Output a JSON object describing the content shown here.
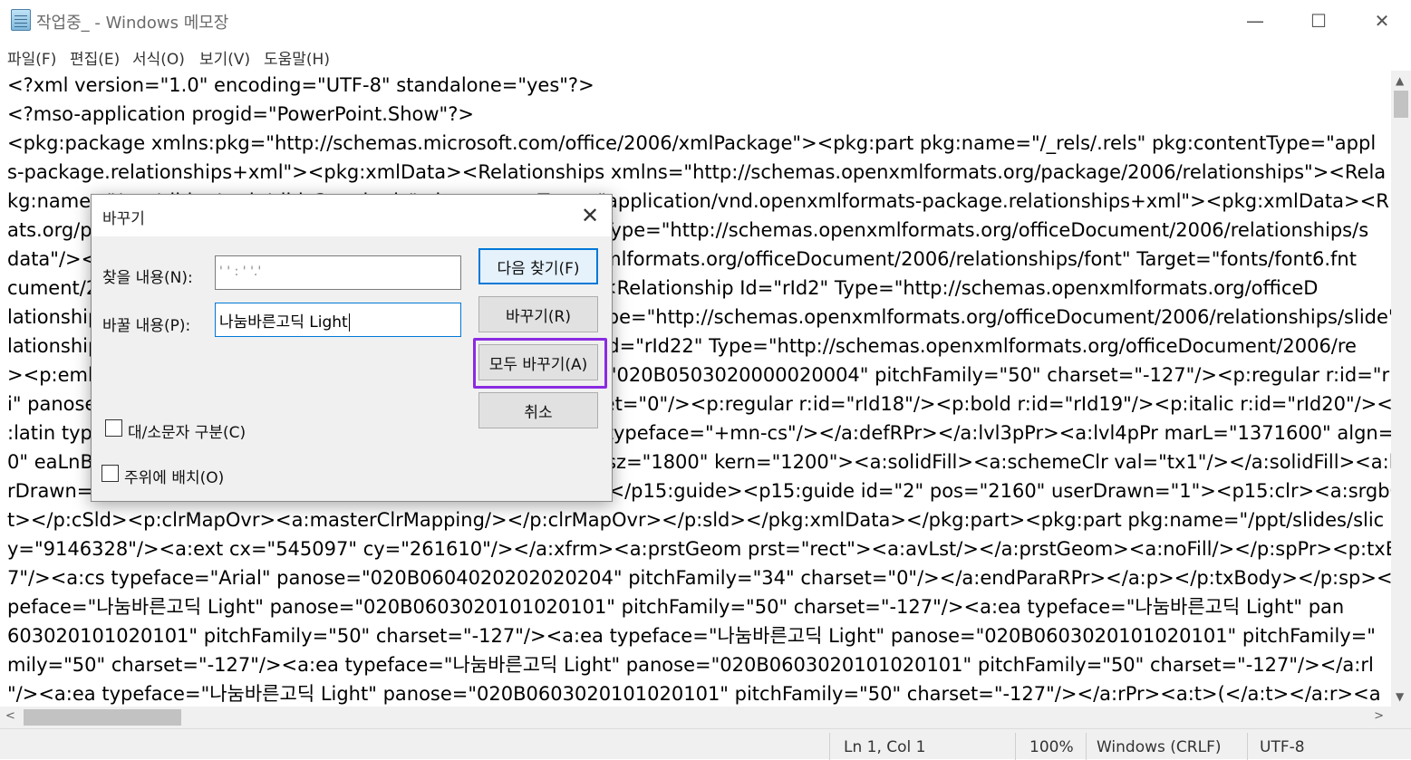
{
  "window": {
    "title": "작업중_ - Windows 메모장",
    "minimize": "—",
    "maximize": "☐",
    "close": "✕"
  },
  "menu": [
    "파일(F)",
    "편집(E)",
    "서식(O)",
    "보기(V)",
    "도움말(H)"
  ],
  "editor_lines": [
    "<?xml version=\"1.0\" encoding=\"UTF-8\" standalone=\"yes\"?>",
    "<?mso-application progid=\"PowerPoint.Show\"?>",
    "<pkg:package xmlns:pkg=\"http://schemas.microsoft.com/office/2006/xmlPackage\"><pkg:part pkg:name=\"/_rels/.rels\" pkg:contentType=\"appl",
    "s-package.relationships+xml\"><pkg:xmlData><Relationships xmlns=\"http://schemas.openxmlformats.org/package/2006/relationships\"><Rela",
    "kg:name=\"/ppt/slides/_rels/slide3.xml.rels\" pkg:contentType=\"application/vnd.openxmlformats-package.relationships+xml\"><pkg:xmlData><R",
    "ats.org/package/2006/relationships\"><Relationship Id=\"rId8\" Type=\"http://schemas.openxmlformats.org/officeDocument/2006/relationships/s",
    "data\"/><Relationship Id=\"rId13\" Type=\"http://schemas.openxmlformats.org/officeDocument/2006/relationships/font\" Target=\"fonts/font6.fnt",
    "cument/2006/relationships/slide\" Target=\"slides/slide3.xml\"/><Relationship Id=\"rId2\" Type=\"http://schemas.openxmlformats.org/officeD",
    "lationships/slide\" Target=\"slides/slide2.xml\"/><Relationship Type=\"http://schemas.openxmlformats.org/officeDocument/2006/relationships/slide\" Target=\"slides/slide4.xml\"/><Relatio",
    "lationships/font\" Target=\"fonts/font3.fntdata\"/><Relationship Id=\"rId22\" Type=\"http://schemas.openxmlformats.org/officeDocument/2006/re",
    "><p:embeddedFont><p:font typeface=\"나눔바른고딕\" panose=\"020B0503020000020004\" pitchFamily=\"50\" charset=\"-127\"/><p:regular r:id=\"rId",
    "i\" panose=\"020B0604020202020204\" pitchFamily=\"34\" charset=\"0\"/><p:regular r:id=\"rId18\"/><p:bold r:id=\"rId19\"/><p:italic r:id=\"rId20\"/><p",
    ":latin typeface=\"+mn-lt\"/><a:ea typeface=\"+mn-ea\"/><a:cs typeface=\"+mn-cs\"/></a:defRPr></a:lvl3pPr><a:lvl4pPr marL=\"1371600\" algn=",
    "0\" eaLnBrk=\"1\" latinLnBrk=\"0\" hangingPunct=\"1\"><a:defRPr sz=\"1800\" kern=\"1200\"><a:solidFill><a:schemeClr val=\"tx1\"/></a:solidFill><a:la",
    "rDrawn=\"1\"><p15:clr><a:srgbClr val=\"A4A3A4\"/></p15:clr></p15:guide><p15:guide id=\"2\" pos=\"2160\" userDrawn=\"1\"><p15:clr><a:srgbC",
    "t></p:cSld><p:clrMapOvr><a:masterClrMapping/></p:clrMapOvr></p:sld></pkg:xmlData></pkg:part><pkg:part pkg:name=\"/ppt/slides/slic",
    "y=\"9146328\"/><a:ext cx=\"545097\" cy=\"261610\"/></a:xfrm><a:prstGeom prst=\"rect\"><a:avLst/></a:prstGeom><a:noFill/></p:spPr><p:txBo",
    "7\"/><a:cs typeface=\"Arial\" panose=\"020B0604020202020204\" pitchFamily=\"34\" charset=\"0\"/></a:endParaRPr></a:p></p:txBody></p:sp><p",
    "peface=\"나눔바른고딕 Light\" panose=\"020B0603020101020101\" pitchFamily=\"50\" charset=\"-127\"/><a:ea typeface=\"나눔바른고딕 Light\" pan",
    "603020101020101\" pitchFamily=\"50\" charset=\"-127\"/><a:ea typeface=\"나눔바른고딕 Light\" panose=\"020B0603020101020101\" pitchFamily=\"",
    "mily=\"50\" charset=\"-127\"/><a:ea typeface=\"나눔바른고딕 Light\" panose=\"020B0603020101020101\" pitchFamily=\"50\" charset=\"-127\"/></a:rl",
    "\"/><a:ea typeface=\"나눔바른고딕 Light\" panose=\"020B0603020101020101\" pitchFamily=\"50\" charset=\"-127\"/></a:rPr><a:t>(</a:t></a:r><a"
  ],
  "status": {
    "position": "Ln 1, Col 1",
    "zoom": "100%",
    "line_ending": "Windows (CRLF)",
    "encoding": "UTF-8"
  },
  "dialog": {
    "title": "바꾸기",
    "close": "✕",
    "find_label": "찾을 내용(N):",
    "find_value": "' ' : ' '.'",
    "replace_label": "바꿀 내용(P):",
    "replace_value": "나눔바른고딕 Light",
    "find_next": "다음 찾기(F)",
    "replace": "바꾸기(R)",
    "replace_all": "모두 바꾸기(A)",
    "cancel": "취소",
    "match_case": "대/소문자 구분(C)",
    "wrap_around": "주위에 배치(O)",
    "highlight_color": "#8a2be2"
  }
}
